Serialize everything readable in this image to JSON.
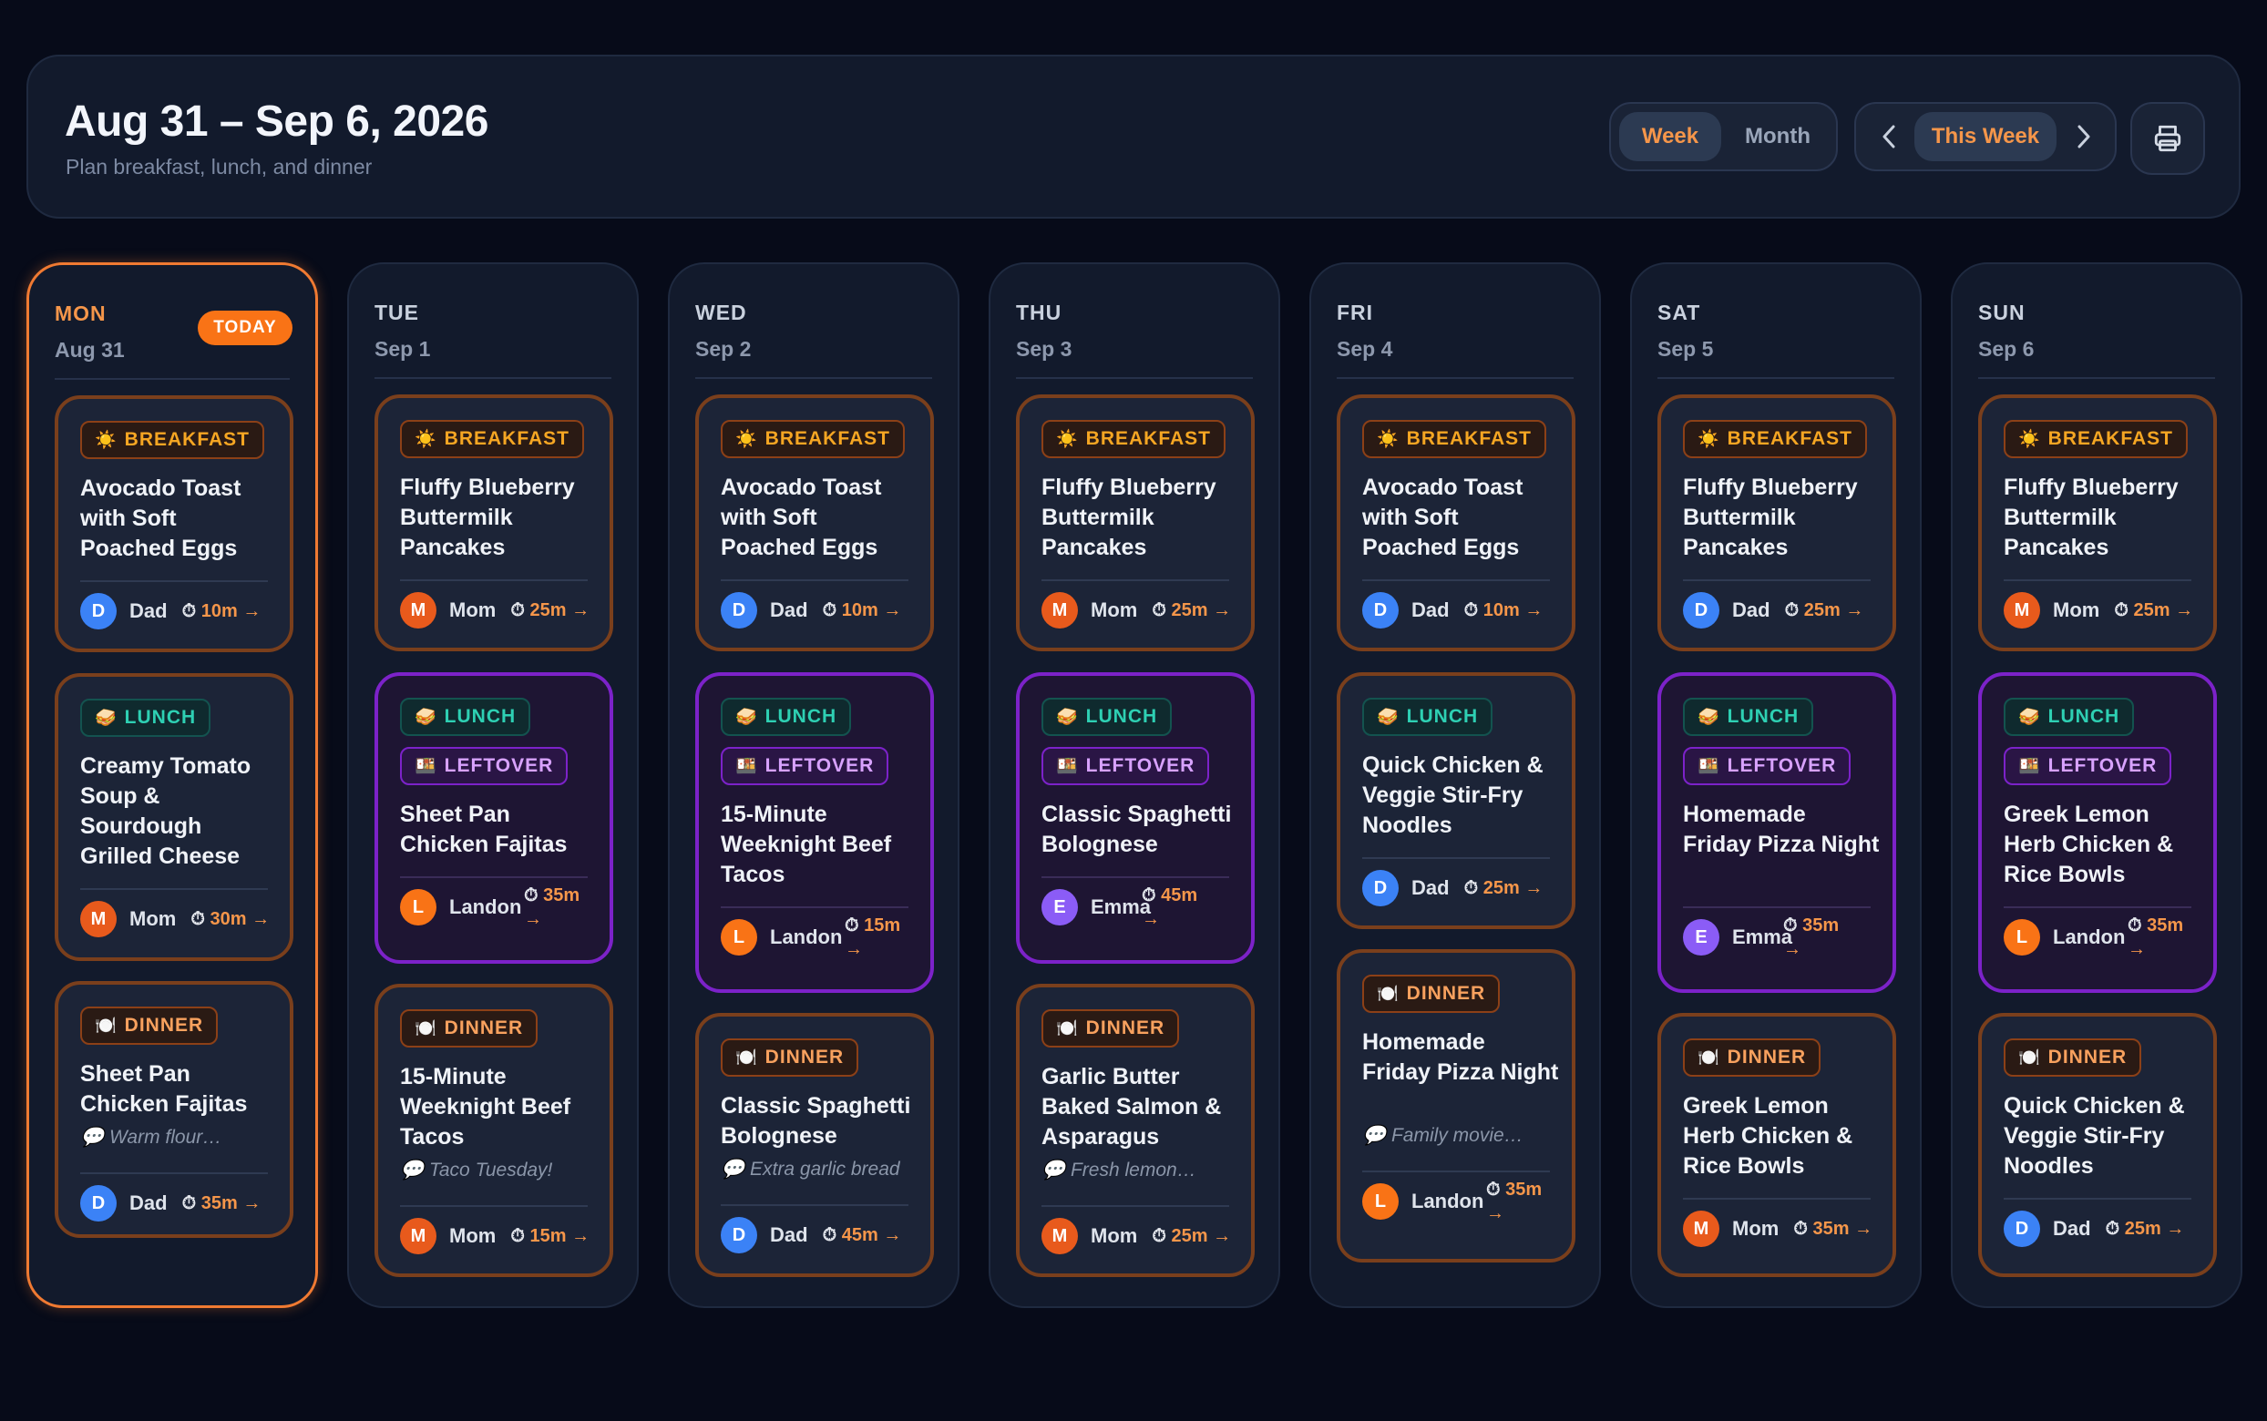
{
  "header": {
    "title": "Aug 31 – Sep 6, 2026",
    "subtitle": "Plan breakfast, lunch, and dinner",
    "view_week": "Week",
    "view_month": "Month",
    "nav_current": "This Week"
  },
  "colors": {
    "accent": "#f97316",
    "breakfast": "#f5a623",
    "lunch": "#2ed0b3",
    "leftover": "#d8a2ff",
    "dinner": "#f8a15e"
  },
  "labels": {
    "today": "TODAY",
    "breakfast": "BREAKFAST",
    "lunch": "LUNCH",
    "dinner": "DINNER",
    "leftover": "LEFTOVER",
    "arrow": "→",
    "clock": "⏱"
  },
  "days": [
    {
      "name": "MON",
      "date": "Aug 31",
      "breakfast": {
        "title": "Avocado Toast with Soft Poached Eggs",
        "initial": "D",
        "owner": "Dad",
        "time": "10m"
      },
      "lunch": {
        "title": "Creamy Tomato Soup & Sourdough Grilled Cheese",
        "initial": "M",
        "owner": "Mom",
        "time": "30m"
      },
      "dinner": {
        "title": "Sheet Pan Chicken Fajitas",
        "note": "💬 Warm flour…",
        "initial": "D",
        "owner": "Dad",
        "time": "35m"
      }
    },
    {
      "name": "TUE",
      "date": "Sep 1",
      "breakfast": {
        "title": "Fluffy Blueberry Buttermilk Pancakes",
        "initial": "M",
        "owner": "Mom",
        "time": "25m"
      },
      "lunch": {
        "title": "Sheet Pan Chicken Fajitas",
        "initial": "L",
        "owner": "Landon",
        "time": "35m"
      },
      "dinner": {
        "title": "15-Minute Weeknight Beef Tacos",
        "note": "💬 Taco Tuesday!",
        "initial": "M",
        "owner": "Mom",
        "time": "15m"
      }
    },
    {
      "name": "WED",
      "date": "Sep 2",
      "breakfast": {
        "title": "Avocado Toast with Soft Poached Eggs",
        "initial": "D",
        "owner": "Dad",
        "time": "10m"
      },
      "lunch": {
        "title": "15-Minute Weeknight Beef Tacos",
        "initial": "L",
        "owner": "Landon",
        "time": "15m"
      },
      "dinner": {
        "title": "Classic Spaghetti Bolognese",
        "note": "💬 Extra garlic bread",
        "initial": "D",
        "owner": "Dad",
        "time": "45m"
      }
    },
    {
      "name": "THU",
      "date": "Sep 3",
      "breakfast": {
        "title": "Fluffy Blueberry Buttermilk Pancakes",
        "initial": "M",
        "owner": "Mom",
        "time": "25m"
      },
      "lunch": {
        "title": "Classic Spaghetti Bolognese",
        "initial": "E",
        "owner": "Emma",
        "time": "45m"
      },
      "dinner": {
        "title": "Garlic Butter Baked Salmon & Asparagus",
        "note": "💬 Fresh lemon…",
        "initial": "M",
        "owner": "Mom",
        "time": "25m"
      }
    },
    {
      "name": "FRI",
      "date": "Sep 4",
      "breakfast": {
        "title": "Avocado Toast with Soft Poached Eggs",
        "initial": "D",
        "owner": "Dad",
        "time": "10m"
      },
      "lunch": {
        "title": "Quick Chicken & Veggie Stir-Fry Noodles",
        "initial": "D",
        "owner": "Dad",
        "time": "25m"
      },
      "dinner": {
        "title": "Homemade Friday Pizza Night",
        "note": "💬 Family movie…",
        "initial": "L",
        "owner": "Landon",
        "time": "35m"
      }
    },
    {
      "name": "SAT",
      "date": "Sep 5",
      "breakfast": {
        "title": "Fluffy Blueberry Buttermilk Pancakes",
        "initial": "D",
        "owner": "Dad",
        "time": "25m"
      },
      "lunch": {
        "title": "Homemade Friday Pizza Night",
        "initial": "E",
        "owner": "Emma",
        "time": "35m"
      },
      "dinner": {
        "title": "Greek Lemon Herb Chicken & Rice Bowls",
        "initial": "M",
        "owner": "Mom",
        "time": "35m"
      }
    },
    {
      "name": "SUN",
      "date": "Sep 6",
      "breakfast": {
        "title": "Fluffy Blueberry Buttermilk Pancakes",
        "initial": "M",
        "owner": "Mom",
        "time": "25m"
      },
      "lunch": {
        "title": "Greek Lemon Herb Chicken & Rice Bowls",
        "initial": "L",
        "owner": "Landon",
        "time": "35m"
      },
      "dinner": {
        "title": "Quick Chicken & Veggie Stir-Fry Noodles",
        "initial": "D",
        "owner": "Dad",
        "time": "25m"
      }
    }
  ]
}
